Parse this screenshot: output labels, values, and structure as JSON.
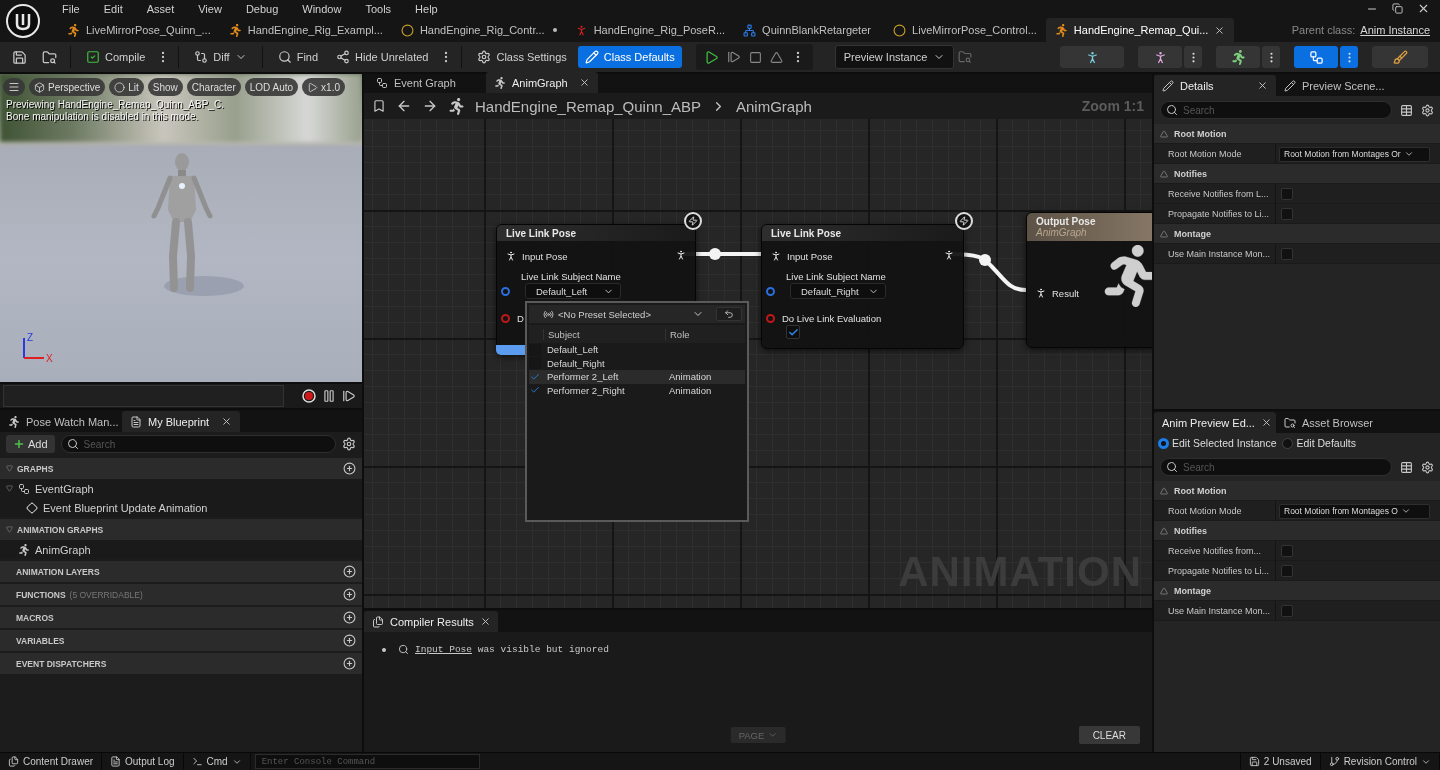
{
  "menu": [
    "File",
    "Edit",
    "Asset",
    "View",
    "Debug",
    "Window",
    "Tools",
    "Help"
  ],
  "document_tabs": [
    {
      "label": "LiveMirrorPose_Quinn_...",
      "selected": false,
      "modified": false
    },
    {
      "label": "HandEngine_Rig_Exampl...",
      "selected": false,
      "modified": false
    },
    {
      "label": "HandEngine_Rig_Contr...",
      "selected": false,
      "modified": true
    },
    {
      "label": "HandEngine_Rig_PoseR...",
      "selected": false,
      "modified": false
    },
    {
      "label": "QuinnBlankRetargeter",
      "selected": false,
      "modified": false
    },
    {
      "label": "LiveMirrorPose_Control...",
      "selected": false,
      "modified": false
    },
    {
      "label": "HandEngine_Remap_Qui...",
      "selected": true,
      "modified": false
    }
  ],
  "parent_class": {
    "label": "Parent class:",
    "value": "Anim Instance"
  },
  "toolbar": {
    "buttons": [
      {
        "label": "Compile",
        "kind": "menu",
        "selected": false
      },
      {
        "label": "Diff",
        "kind": "dropdown",
        "selected": false
      },
      {
        "label": "Find",
        "kind": "plain",
        "selected": false
      },
      {
        "label": "Hide Unrelated",
        "kind": "menu",
        "selected": false
      },
      {
        "label": "Class Settings",
        "kind": "plain",
        "selected": false
      },
      {
        "label": "Class Defaults",
        "kind": "plain",
        "selected": true
      }
    ],
    "preview_instance": "Preview Instance",
    "modes": [
      {
        "selected": false
      },
      {
        "selected": false
      },
      {
        "selected": false
      },
      {
        "selected": true
      },
      {
        "selected": false
      }
    ]
  },
  "viewport": {
    "buttons": [
      "Perspective",
      "Lit",
      "Show",
      "Character",
      "LOD Auto",
      "x1.0"
    ],
    "overlay": [
      "Previewing HandEngine_Remap_Quinn_ABP_C.",
      "Bone manipulation is disabled in this mode."
    ],
    "axis_labels": [
      "Z",
      "X"
    ]
  },
  "blueprint": {
    "tabs": [
      {
        "label": "Pose Watch Man...",
        "selected": false
      },
      {
        "label": "My Blueprint",
        "selected": true
      }
    ],
    "add": "Add",
    "search_placeholder": "Search",
    "sections": [
      {
        "title": "GRAPHS",
        "expanded": true,
        "addable": true,
        "items": [
          {
            "label": "EventGraph",
            "kind": "graph",
            "children": [
              {
                "label": "Event Blueprint Update Animation",
                "kind": "event"
              }
            ]
          }
        ]
      },
      {
        "title": "ANIMATION GRAPHS",
        "expanded": true,
        "addable": false,
        "items": [
          {
            "label": "AnimGraph",
            "kind": "anim"
          }
        ]
      },
      {
        "title": "ANIMATION LAYERS",
        "expanded": false,
        "addable": true
      },
      {
        "title": "FUNCTIONS",
        "note": "(5 OVERRIDABLE)",
        "expanded": false,
        "addable": true
      },
      {
        "title": "MACROS",
        "expanded": false,
        "addable": true
      },
      {
        "title": "VARIABLES",
        "expanded": false,
        "addable": true
      },
      {
        "title": "EVENT DISPATCHERS",
        "expanded": false,
        "addable": true
      }
    ]
  },
  "graph": {
    "tabs": [
      {
        "label": "Event Graph",
        "selected": false
      },
      {
        "label": "AnimGraph",
        "selected": true
      }
    ],
    "breadcrumb": [
      "HandEngine_Remap_Quinn_ABP",
      "AnimGraph"
    ],
    "zoom": "Zoom 1:1",
    "watermark": "ANIMATION",
    "nodes": [
      {
        "kind": "live_link",
        "title": "Live Link Pose",
        "input": "Input Pose",
        "subject_label": "Live Link Subject Name",
        "subject": "Default_Left",
        "evaluation": {
          "label": "D"
        }
      },
      {
        "kind": "live_link",
        "title": "Live Link Pose",
        "input": "Input Pose",
        "subject_label": "Live Link Subject Name",
        "subject": "Default_Right",
        "evaluation": {
          "label": "Do Live Link Evaluation",
          "checked": true
        }
      },
      {
        "kind": "output",
        "title": "Output Pose",
        "subtitle": "AnimGraph",
        "input": "Result"
      }
    ],
    "popup": {
      "preset": "<No Preset Selected>",
      "columns": [
        "Subject",
        "Role"
      ],
      "rows": [
        {
          "subject": "Default_Left",
          "role": "",
          "checked": false,
          "selected": false
        },
        {
          "subject": "Default_Right",
          "role": "",
          "checked": false,
          "selected": false
        },
        {
          "subject": "Performer 2_Left",
          "role": "Animation",
          "checked": true,
          "selected": true
        },
        {
          "subject": "Performer 2_Right",
          "role": "Animation",
          "checked": true,
          "selected": false
        }
      ]
    }
  },
  "compiler": {
    "tab": "Compiler Results",
    "messages": [
      {
        "link": "Input Pose",
        "text": "was visible but ignored"
      }
    ],
    "page": {
      "label": "PAGE",
      "disabled": true
    },
    "clear": "CLEAR"
  },
  "details": {
    "tabs": [
      {
        "label": "Details",
        "selected": true
      },
      {
        "label": "Preview Scene...",
        "selected": false
      }
    ],
    "search_placeholder": "Search",
    "sections": [
      {
        "title": "Root Motion",
        "rows": [
          {
            "label": "Root Motion Mode",
            "kind": "dropdown",
            "value": "Root Motion from Montages Or"
          }
        ]
      },
      {
        "title": "Notifies",
        "rows": [
          {
            "label": "Receive Notifies from L...",
            "kind": "checkbox",
            "checked": false
          },
          {
            "label": "Propagate Notifies to Li...",
            "kind": "checkbox",
            "checked": false
          }
        ]
      },
      {
        "title": "Montage",
        "rows": [
          {
            "label": "Use Main Instance Mon...",
            "kind": "checkbox",
            "checked": false
          }
        ]
      }
    ]
  },
  "preview": {
    "tabs": [
      {
        "label": "Anim Preview Ed...",
        "selected": true
      },
      {
        "label": "Asset Browser",
        "selected": false
      }
    ],
    "radios": [
      {
        "label": "Edit Selected Instance",
        "selected": true
      },
      {
        "label": "Edit Defaults",
        "selected": false
      }
    ],
    "search_placeholder": "Search",
    "sections": [
      {
        "title": "Root Motion",
        "rows": [
          {
            "label": "Root Motion Mode",
            "kind": "dropdown",
            "value": "Root Motion from Montages O"
          }
        ]
      },
      {
        "title": "Notifies",
        "rows": [
          {
            "label": "Receive Notifies from...",
            "kind": "checkbox",
            "checked": false
          },
          {
            "label": "Propagate Notifies to Li...",
            "kind": "checkbox",
            "checked": false
          }
        ]
      },
      {
        "title": "Montage",
        "rows": [
          {
            "label": "Use Main Instance Mon...",
            "kind": "checkbox",
            "checked": false
          }
        ]
      }
    ]
  },
  "status_bar": {
    "left": [
      "Content Drawer",
      "Output Log"
    ],
    "cmd": "Cmd",
    "console_placeholder": "Enter Console Command",
    "unsaved": "2 Unsaved",
    "revision": "Revision Control"
  }
}
